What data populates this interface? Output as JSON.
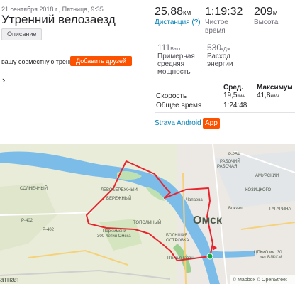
{
  "activity": {
    "date": "21 сентября 2018 г., Пятница, 9:35",
    "title": "Утренний велозаезд",
    "description_chip": "Описание",
    "friends_prompt": "вашу совместную тренировку?",
    "add_friends_label": "Добавить друзей",
    "more_glyph": "›"
  },
  "stats": {
    "distance": {
      "value": "25,88",
      "unit": "км",
      "label": "Дистанция (?)"
    },
    "moving_time": {
      "value": "1:19:32",
      "label": "Чистое время"
    },
    "elevation": {
      "value": "209",
      "unit": "м",
      "label": "Высота"
    },
    "power": {
      "value": "111",
      "unit": "Ватт",
      "label": "Примерная средняя мощность"
    },
    "energy": {
      "value": "530",
      "unit": "кДж",
      "label": "Расход энергии"
    }
  },
  "table": {
    "col_avg": "Сред.",
    "col_max": "Максимум",
    "rows": [
      {
        "label": "Скорость",
        "avg": "19,5",
        "avg_unit": "км/ч",
        "max": "41,8",
        "max_unit": "км/ч"
      },
      {
        "label": "Общее время",
        "avg": "1:24:48",
        "max": ""
      }
    ]
  },
  "device": {
    "name": "Strava Android",
    "badge": "App"
  },
  "map": {
    "labels": {
      "omsk": "Омск",
      "park": "Парк имени",
      "park2": "300-летия Омска",
      "left_bank": "ЛЕВОБЕРЕЖНЫЙ",
      "beregovoy": "БЕРЕЖНЫЙ",
      "topolinyi": "ТОПОЛИНЫЙ",
      "solnechnyi": "СОЛНЕЧНЫЙ",
      "bolshaya": "БОЛЬШАЯ",
      "ostrovka": "ОСТРОВКА",
      "amursky": "АМУРСКИЙ",
      "kozitskogo": "КОЗИЦКОГО",
      "rabochiy": "РАБОЧИЙ",
      "rabochaya": "РАБОЧАЯ",
      "gagarin": "ГАГАРИНА",
      "vokzal": "Вокзал",
      "pticha": "Птичья гавань",
      "vlksm": "ЦПКиО им. 30",
      "vlksm2": "лет ВЛКСМ",
      "r402a": "Р-402",
      "r402b": "Р-402",
      "r254": "Р-254",
      "natnaya": "атная",
      "chapaeva": "Чапаева",
      "attribution": "© Mapbox © OpenStreet"
    },
    "colors": {
      "route": "#e8252e",
      "water": "#7bbde8",
      "land": "#e9ecd9",
      "start": "#15a542"
    }
  }
}
